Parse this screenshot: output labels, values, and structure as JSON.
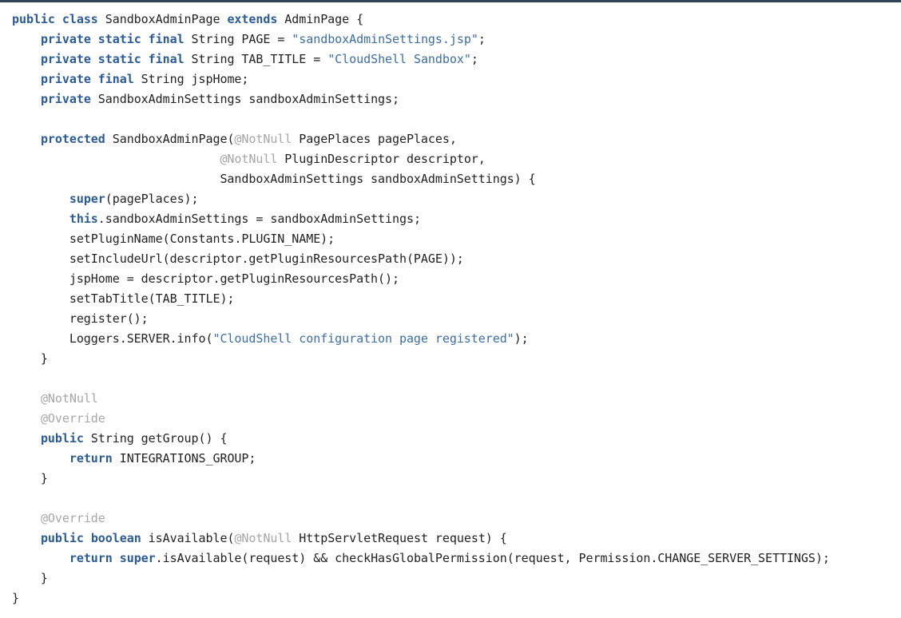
{
  "editor": {
    "language": "java",
    "file_name": "SandboxAdminPage.java",
    "colors": {
      "background": "#ffffff",
      "top_rule": "#33425b",
      "keyword": "#2b5b96",
      "string": "#3b6ea5",
      "annotation": "#a6a6a6",
      "plain_text": "#222222"
    }
  },
  "code": {
    "lines": [
      {
        "indent": 0,
        "tokens": [
          {
            "t": "kw",
            "s": "public"
          },
          {
            "t": "plain",
            "s": " "
          },
          {
            "t": "kw",
            "s": "class"
          },
          {
            "t": "plain",
            "s": " SandboxAdminPage "
          },
          {
            "t": "kw",
            "s": "extends"
          },
          {
            "t": "plain",
            "s": " AdminPage {"
          }
        ]
      },
      {
        "indent": 0,
        "tokens": [
          {
            "t": "plain",
            "s": "    "
          },
          {
            "t": "kw",
            "s": "private"
          },
          {
            "t": "plain",
            "s": " "
          },
          {
            "t": "kw",
            "s": "static"
          },
          {
            "t": "plain",
            "s": " "
          },
          {
            "t": "kw",
            "s": "final"
          },
          {
            "t": "plain",
            "s": " String PAGE = "
          },
          {
            "t": "str",
            "s": "\"sandboxAdminSettings.jsp\""
          },
          {
            "t": "plain",
            "s": ";"
          }
        ]
      },
      {
        "indent": 0,
        "tokens": [
          {
            "t": "plain",
            "s": "    "
          },
          {
            "t": "kw",
            "s": "private"
          },
          {
            "t": "plain",
            "s": " "
          },
          {
            "t": "kw",
            "s": "static"
          },
          {
            "t": "plain",
            "s": " "
          },
          {
            "t": "kw",
            "s": "final"
          },
          {
            "t": "plain",
            "s": " String TAB_TITLE = "
          },
          {
            "t": "str",
            "s": "\"CloudShell Sandbox\""
          },
          {
            "t": "plain",
            "s": ";"
          }
        ]
      },
      {
        "indent": 0,
        "tokens": [
          {
            "t": "plain",
            "s": "    "
          },
          {
            "t": "kw",
            "s": "private"
          },
          {
            "t": "plain",
            "s": " "
          },
          {
            "t": "kw",
            "s": "final"
          },
          {
            "t": "plain",
            "s": " String jspHome;"
          }
        ]
      },
      {
        "indent": 0,
        "tokens": [
          {
            "t": "plain",
            "s": "    "
          },
          {
            "t": "kw",
            "s": "private"
          },
          {
            "t": "plain",
            "s": " SandboxAdminSettings sandboxAdminSettings;"
          }
        ]
      },
      {
        "indent": 0,
        "tokens": []
      },
      {
        "indent": 0,
        "tokens": [
          {
            "t": "plain",
            "s": "    "
          },
          {
            "t": "kw",
            "s": "protected"
          },
          {
            "t": "plain",
            "s": " SandboxAdminPage("
          },
          {
            "t": "ann",
            "s": "@NotNull"
          },
          {
            "t": "plain",
            "s": " PagePlaces pagePlaces,"
          }
        ]
      },
      {
        "indent": 0,
        "tokens": [
          {
            "t": "plain",
            "s": "                             "
          },
          {
            "t": "ann",
            "s": "@NotNull"
          },
          {
            "t": "plain",
            "s": " PluginDescriptor descriptor,"
          }
        ]
      },
      {
        "indent": 0,
        "tokens": [
          {
            "t": "plain",
            "s": "                             SandboxAdminSettings sandboxAdminSettings) {"
          }
        ]
      },
      {
        "indent": 0,
        "tokens": [
          {
            "t": "plain",
            "s": "        "
          },
          {
            "t": "kw",
            "s": "super"
          },
          {
            "t": "plain",
            "s": "(pagePlaces);"
          }
        ]
      },
      {
        "indent": 0,
        "tokens": [
          {
            "t": "plain",
            "s": "        "
          },
          {
            "t": "kw",
            "s": "this"
          },
          {
            "t": "plain",
            "s": ".sandboxAdminSettings = sandboxAdminSettings;"
          }
        ]
      },
      {
        "indent": 0,
        "tokens": [
          {
            "t": "plain",
            "s": "        setPluginName(Constants.PLUGIN_NAME);"
          }
        ]
      },
      {
        "indent": 0,
        "tokens": [
          {
            "t": "plain",
            "s": "        setIncludeUrl(descriptor.getPluginResourcesPath(PAGE));"
          }
        ]
      },
      {
        "indent": 0,
        "tokens": [
          {
            "t": "plain",
            "s": "        jspHome = descriptor.getPluginResourcesPath();"
          }
        ]
      },
      {
        "indent": 0,
        "tokens": [
          {
            "t": "plain",
            "s": "        setTabTitle(TAB_TITLE);"
          }
        ]
      },
      {
        "indent": 0,
        "tokens": [
          {
            "t": "plain",
            "s": "        register();"
          }
        ]
      },
      {
        "indent": 0,
        "tokens": [
          {
            "t": "plain",
            "s": "        Loggers.SERVER.info("
          },
          {
            "t": "str",
            "s": "\"CloudShell configuration page registered\""
          },
          {
            "t": "plain",
            "s": ");"
          }
        ]
      },
      {
        "indent": 0,
        "tokens": [
          {
            "t": "plain",
            "s": "    }"
          }
        ]
      },
      {
        "indent": 0,
        "tokens": []
      },
      {
        "indent": 0,
        "tokens": [
          {
            "t": "plain",
            "s": "    "
          },
          {
            "t": "ann",
            "s": "@NotNull"
          }
        ]
      },
      {
        "indent": 0,
        "tokens": [
          {
            "t": "plain",
            "s": "    "
          },
          {
            "t": "ann",
            "s": "@Override"
          }
        ]
      },
      {
        "indent": 0,
        "tokens": [
          {
            "t": "plain",
            "s": "    "
          },
          {
            "t": "kw",
            "s": "public"
          },
          {
            "t": "plain",
            "s": " String getGroup() {"
          }
        ]
      },
      {
        "indent": 0,
        "tokens": [
          {
            "t": "plain",
            "s": "        "
          },
          {
            "t": "kw",
            "s": "return"
          },
          {
            "t": "plain",
            "s": " INTEGRATIONS_GROUP;"
          }
        ]
      },
      {
        "indent": 0,
        "tokens": [
          {
            "t": "plain",
            "s": "    }"
          }
        ]
      },
      {
        "indent": 0,
        "tokens": []
      },
      {
        "indent": 0,
        "tokens": [
          {
            "t": "plain",
            "s": "    "
          },
          {
            "t": "ann",
            "s": "@Override"
          }
        ]
      },
      {
        "indent": 0,
        "tokens": [
          {
            "t": "plain",
            "s": "    "
          },
          {
            "t": "kw",
            "s": "public"
          },
          {
            "t": "plain",
            "s": " "
          },
          {
            "t": "kw",
            "s": "boolean"
          },
          {
            "t": "plain",
            "s": " isAvailable("
          },
          {
            "t": "ann",
            "s": "@NotNull"
          },
          {
            "t": "plain",
            "s": " HttpServletRequest request) {"
          }
        ]
      },
      {
        "indent": 0,
        "tokens": [
          {
            "t": "plain",
            "s": "        "
          },
          {
            "t": "kw",
            "s": "return"
          },
          {
            "t": "plain",
            "s": " "
          },
          {
            "t": "kw",
            "s": "super"
          },
          {
            "t": "plain",
            "s": ".isAvailable(request) && checkHasGlobalPermission(request, Permission.CHANGE_SERVER_SETTINGS);"
          }
        ]
      },
      {
        "indent": 0,
        "tokens": [
          {
            "t": "plain",
            "s": "    }"
          }
        ]
      },
      {
        "indent": 0,
        "tokens": [
          {
            "t": "plain",
            "s": "}"
          }
        ]
      }
    ]
  }
}
